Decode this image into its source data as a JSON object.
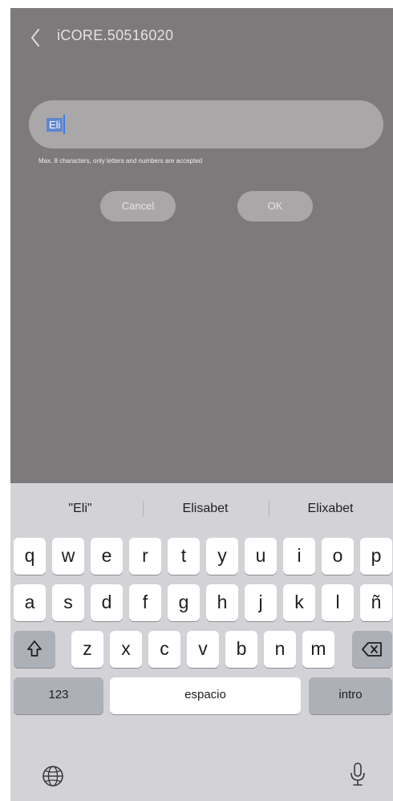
{
  "header": {
    "title": "iCORE.50516020"
  },
  "name_field": {
    "value": "Eli",
    "hint": "Max. 8 characters, only letters and numbers are accepted"
  },
  "dialog": {
    "cancel_label": "Cancel",
    "ok_label": "OK"
  },
  "keyboard": {
    "suggestions": [
      "\"Eli\"",
      "Elisabet",
      "Elixabet"
    ],
    "row1": [
      "q",
      "w",
      "e",
      "r",
      "t",
      "y",
      "u",
      "i",
      "o",
      "p"
    ],
    "row2": [
      "a",
      "s",
      "d",
      "f",
      "g",
      "h",
      "j",
      "k",
      "l",
      "ñ"
    ],
    "row3": [
      "z",
      "x",
      "c",
      "v",
      "b",
      "n",
      "m"
    ],
    "numbers_label": "123",
    "space_label": "espacio",
    "return_label": "intro",
    "icons": {
      "shift": "shift-icon",
      "delete": "delete-icon",
      "globe": "globe-icon",
      "mic": "microphone-icon"
    }
  },
  "colors": {
    "overlay": "#7d7a7c",
    "keyboard_bg": "#d3d2d7",
    "key_bg": "#ffffff",
    "function_key_bg": "#adb0b7",
    "input_bg": "#a9a7a8"
  }
}
